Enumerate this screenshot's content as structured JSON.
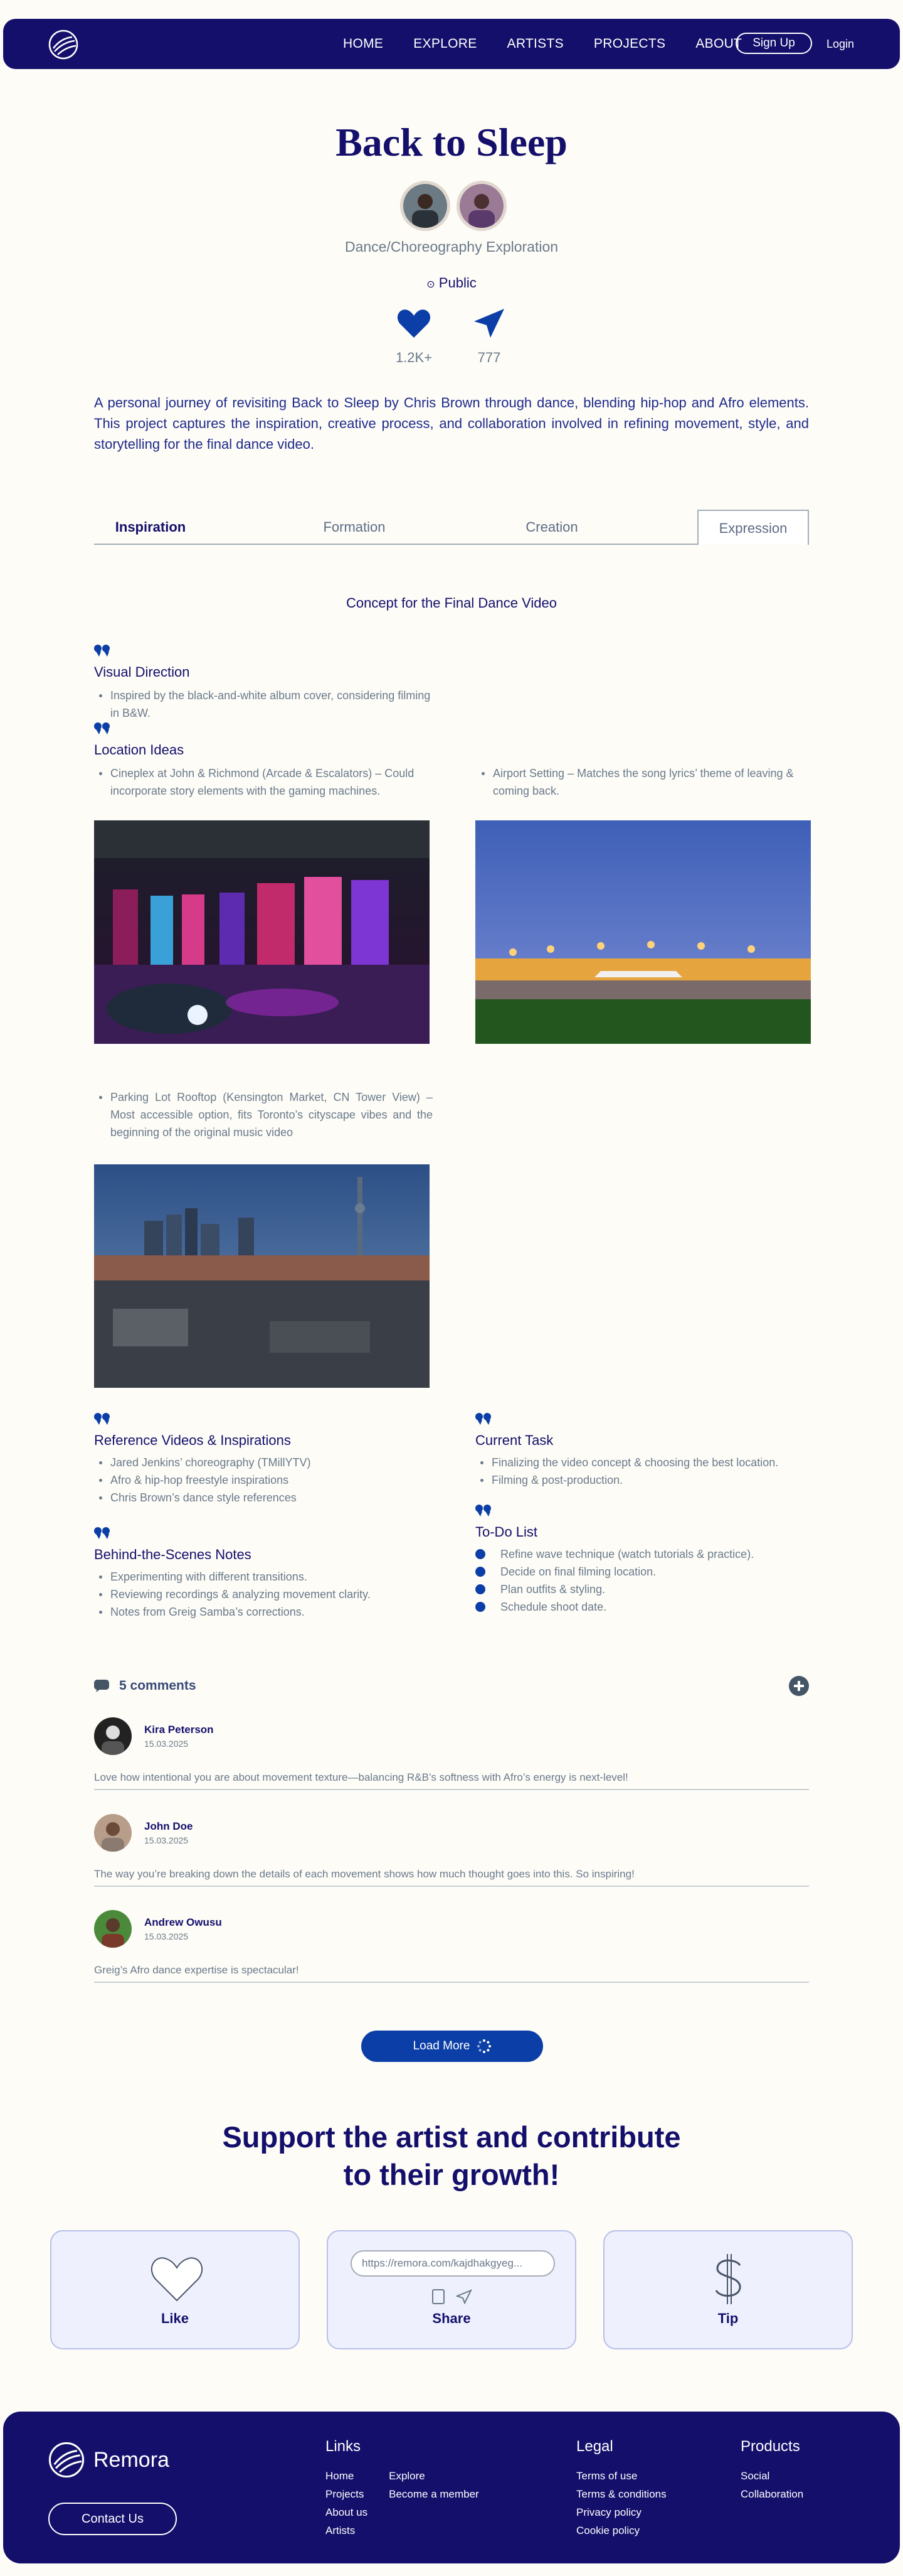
{
  "nav": {
    "links": [
      "HOME",
      "EXPLORE",
      "ARTISTS",
      "PROJECTS",
      "ABOUT"
    ],
    "signup": "Sign Up",
    "login": "Login"
  },
  "hero": {
    "title": "Back to Sleep",
    "subtitle": "Dance/Choreography Exploration",
    "visibility": "Public",
    "likes": "1.2K+",
    "shares": "777",
    "description": "A personal journey of revisiting Back to Sleep by Chris Brown through dance, blending hip-hop and Afro elements. This project captures the inspiration, creative process, and collaboration involved in refining movement, style, and storytelling for the final dance video."
  },
  "tabs": [
    "Inspiration",
    "Formation",
    "Creation",
    "Expression"
  ],
  "concept": {
    "title": "Concept for the Final Dance Video",
    "visual_direction": {
      "heading": "Visual Direction",
      "items": [
        "Inspired by the black-and-white album cover, considering filming in B&W."
      ]
    },
    "location_ideas": {
      "heading": "Location Ideas",
      "item_1": "Cineplex at John & Richmond (Arcade & Escalators) – Could incorporate story elements with the gaming machines.",
      "item_2": "Airport Setting – Matches the song lyrics’ theme of leaving & coming back.",
      "item_3": "Parking Lot Rooftop (Kensington Market, CN Tower View) – Most accessible option, fits Toronto’s cityscape vibes and the beginning of the original music video"
    },
    "reference_videos": {
      "heading": "Reference Videos & Inspirations",
      "items": [
        "Jared Jenkins’ choreography (TMillYTV)",
        "Afro & hip-hop freestyle inspirations",
        "Chris Brown’s dance style references"
      ]
    },
    "current_task": {
      "heading": "Current Task",
      "items": [
        "Finalizing the video concept & choosing the best location.",
        "Filming & post-production."
      ]
    },
    "bts_notes": {
      "heading": "Behind-the-Scenes Notes",
      "items": [
        "Experimenting with different transitions.",
        "Reviewing recordings & analyzing movement clarity.",
        "Notes from Greig Samba’s corrections."
      ]
    },
    "todo": {
      "heading": "To-Do List",
      "items": [
        "Refine wave technique (watch tutorials & practice).",
        "Decide on final filming location.",
        "Plan outfits & styling.",
        "Schedule shoot date."
      ]
    }
  },
  "comments": {
    "count_label": "5 comments",
    "list": [
      {
        "name": "Kira Peterson",
        "date": "15.03.2025",
        "text": "Love how intentional you are about movement texture—balancing R&B’s softness with Afro’s energy is next-level!"
      },
      {
        "name": "John Doe",
        "date": "15.03.2025",
        "text": "The way you’re breaking down the details of each movement shows how much thought goes into this. So inspiring!"
      },
      {
        "name": "Andrew Owusu",
        "date": "15.03.2025",
        "text": "Greig’s Afro dance expertise is spectacular!"
      }
    ],
    "load_more": "Load More"
  },
  "support": {
    "line1": "Support the artist and contribute",
    "line2": "to their growth!",
    "like_label": "Like",
    "share_label": "Share",
    "share_url": "https://remora.com/kajdhakgyeg...",
    "tip_label": "Tip"
  },
  "footer": {
    "brand": "Remora",
    "contact": "Contact Us",
    "links_heading": "Links",
    "links_col1": [
      "Home",
      "Projects",
      "About us",
      "Artists"
    ],
    "links_col2": [
      "Explore",
      "Become a member"
    ],
    "legal_heading": "Legal",
    "legal": [
      "Terms of use",
      "Terms & conditions",
      "Privacy policy",
      "Cookie policy"
    ],
    "products_heading": "Products",
    "products": [
      "Social",
      "Collaboration"
    ]
  },
  "colors": {
    "navy": "#140f6b",
    "accent_blue": "#0b3ea6",
    "muted_text": "#6a7a8a",
    "background": "#fdfcf7",
    "card_bg": "#eef0fd"
  },
  "icons": [
    "remora-logo-icon",
    "heart-icon",
    "send-icon",
    "quote-icon",
    "comment-bubble-icon",
    "plus-circle-icon",
    "check-icon",
    "spinner-icon",
    "copy-icon",
    "dollar-icon"
  ]
}
